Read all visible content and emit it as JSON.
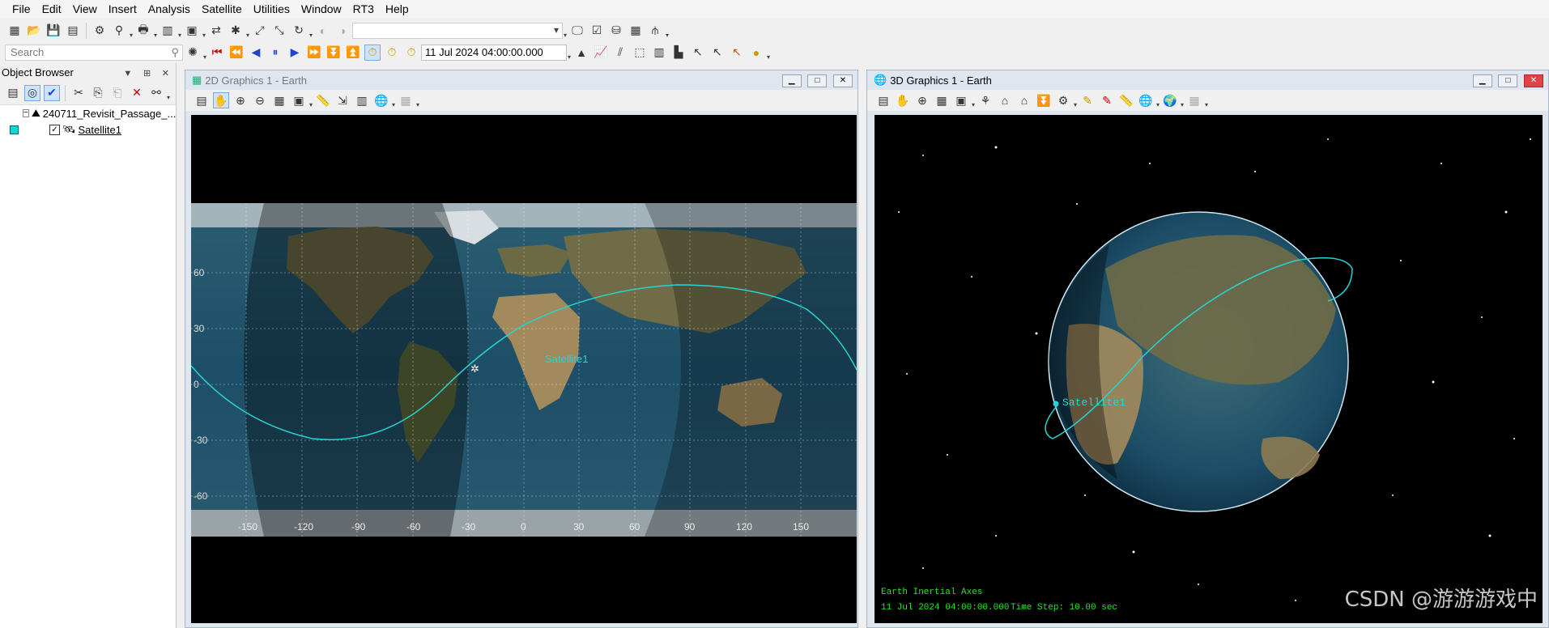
{
  "menu": [
    "File",
    "Edit",
    "View",
    "Insert",
    "Analysis",
    "Satellite",
    "Utilities",
    "Window",
    "RT3",
    "Help"
  ],
  "search": {
    "placeholder": "Search"
  },
  "animation": {
    "current_time": "11 Jul 2024 04:00:00.000"
  },
  "object_browser": {
    "title": "Object Browser",
    "scenario": "240711_Revisit_Passage_...",
    "satellite": "Satellite1"
  },
  "window2d": {
    "title": "2D Graphics 1 - Earth",
    "lat_labels": [
      "60",
      "30",
      "0",
      "-30",
      "-60"
    ],
    "lon_labels": [
      "-150",
      "-120",
      "-90",
      "-60",
      "-30",
      "0",
      "30",
      "60",
      "90",
      "120",
      "150"
    ],
    "satellite_label": "Satellite1"
  },
  "window3d": {
    "title": "3D Graphics 1 - Earth",
    "satellite_label": "Satellite1",
    "axes_text": "Earth Inertial Axes",
    "time_text": "11 Jul 2024 04:00:00.000",
    "step_text": "Time Step: 10.00 sec",
    "watermark": "CSDN @游游游戏中"
  },
  "colors": {
    "orbit": "#27d3d3",
    "hud_text": "#25e825",
    "ocean": "#1f4f66",
    "land": "#6b6a44"
  }
}
